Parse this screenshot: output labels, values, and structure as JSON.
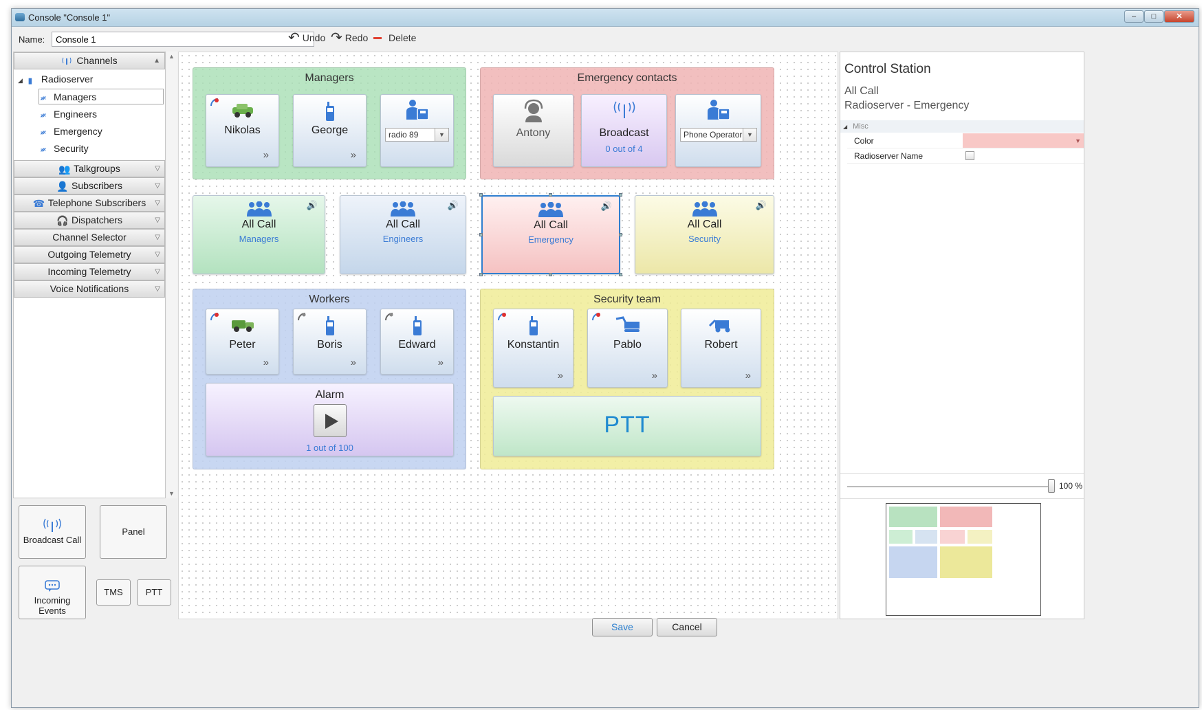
{
  "window": {
    "title": "Console \"Console 1\"",
    "buttons": [
      "–",
      "□",
      "✕"
    ]
  },
  "namebar": {
    "label": "Name:",
    "value": "Console 1",
    "undo": "Undo",
    "redo": "Redo",
    "delete": "Delete"
  },
  "left": {
    "channels": "Channels",
    "radioserver": "Radioserver",
    "tree": [
      "Managers",
      "Engineers",
      "Emergency",
      "Security"
    ],
    "sections": [
      "Talkgroups",
      "Subscribers",
      "Telephone Subscribers",
      "Dispatchers",
      "Channel Selector",
      "Outgoing Telemetry",
      "Incoming Telemetry",
      "Voice Notifications"
    ],
    "tools": {
      "broadcast": "Broadcast Call",
      "panel": "Panel",
      "incoming": "Incoming Events",
      "tms": "TMS",
      "ptt": "PTT"
    }
  },
  "canvas": {
    "managers": {
      "title": "Managers",
      "nikolas": "Nikolas",
      "george": "George",
      "radio": "radio 89"
    },
    "emergency": {
      "title": "Emergency contacts",
      "antony": "Antony",
      "broadcast": "Broadcast",
      "broadcast_sub": "0 out of 4",
      "phone": "Phone Operator"
    },
    "allcalls": [
      {
        "title": "All Call",
        "sub": "Managers",
        "color": "#cfeed5"
      },
      {
        "title": "All Call",
        "sub": "Engineers",
        "color": "#d6e3f1"
      },
      {
        "title": "All Call",
        "sub": "Emergency",
        "color": "#f9d3d3"
      },
      {
        "title": "All Call",
        "sub": "Security",
        "color": "#f4f1c2"
      }
    ],
    "workers": {
      "title": "Workers",
      "peter": "Peter",
      "boris": "Boris",
      "edward": "Edward",
      "alarm": "Alarm",
      "alarm_sub": "1 out of 100"
    },
    "security": {
      "title": "Security team",
      "konstantin": "Konstantin",
      "pablo": "Pablo",
      "robert": "Robert",
      "ptt": "PTT"
    }
  },
  "right": {
    "title": "Control Station",
    "line1": "All Call",
    "line2": "Radioserver - Emergency",
    "section": "Misc",
    "props": {
      "color": "Color",
      "radioserver_name": "Radioserver Name"
    },
    "color_value": "#f8c8c6",
    "zoom": "100 %"
  },
  "footer": {
    "save": "Save",
    "cancel": "Cancel"
  }
}
